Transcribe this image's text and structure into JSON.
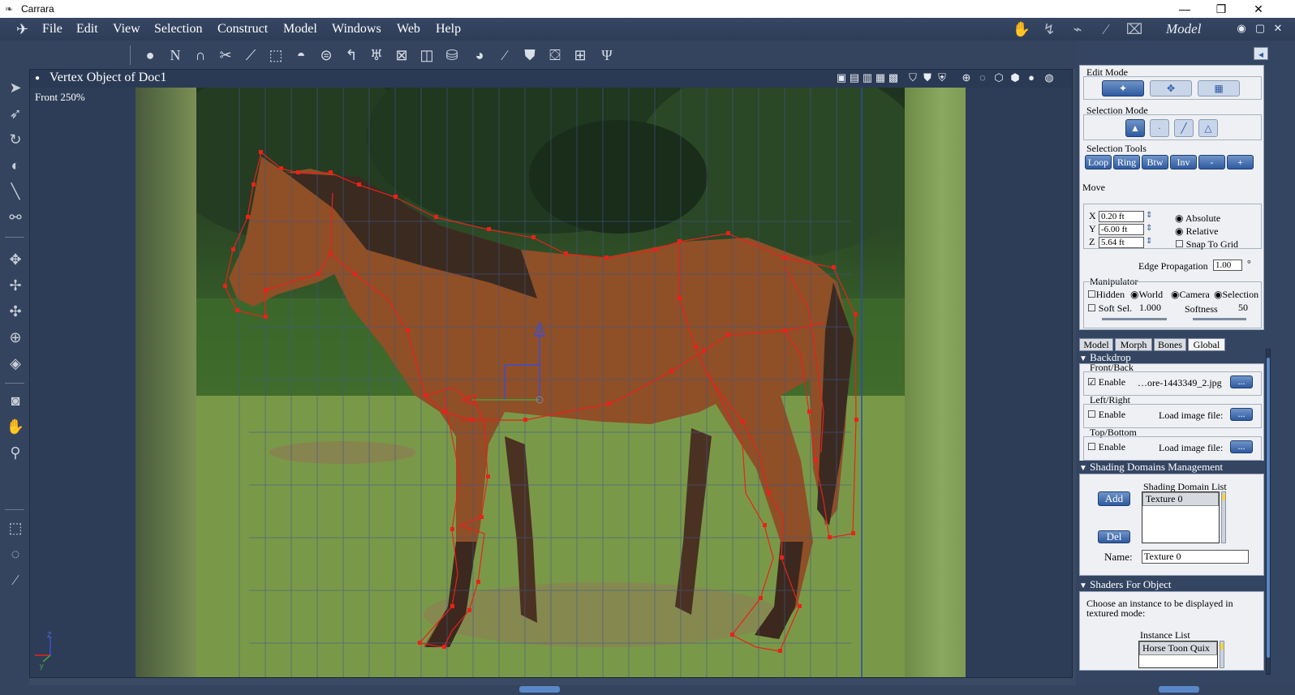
{
  "window": {
    "title": "Carrara",
    "minimize_glyph": "—",
    "restore_glyph": "❐",
    "close_glyph": "✕"
  },
  "menubar": {
    "items": [
      "File",
      "Edit",
      "View",
      "Selection",
      "Construct",
      "Model",
      "Windows",
      "Web",
      "Help"
    ],
    "room_label": "Model",
    "room_icons": [
      "assemble-room-icon",
      "model-room-icon",
      "storyboard-room-icon",
      "texture-room-icon",
      "render-room-icon"
    ]
  },
  "toolbar": {
    "tools": [
      "sphere-tool-icon",
      "spline-tool-icon",
      "magnet-tool-icon",
      "scissors-tool-icon",
      "knife-tool-icon",
      "scale-tool-icon",
      "dome-tool-icon",
      "lathe-tool-icon",
      "bend-tool-icon",
      "vase-tool-icon",
      "box-select-tool-icon",
      "cube-tool-icon",
      "cylinder-tool-icon",
      "cone-tool-icon",
      "pen-tool-icon",
      "deform-tool-icon",
      "morph-tool-icon",
      "extrude-tool-icon",
      "sweep-tool-icon"
    ]
  },
  "lefttools": {
    "tools": [
      "arrow-icon",
      "direct-select-icon",
      "rotate-icon",
      "trackball-icon",
      "measure-icon",
      "link-icon",
      "move-xy-icon",
      "move-xz-icon",
      "move-yz-icon",
      "move-3d-icon",
      "shading-icon",
      "camera-icon",
      "hand-icon",
      "zoom-icon",
      "marquee-icon",
      "lasso-icon",
      "brush-icon"
    ]
  },
  "viewport": {
    "title": "Vertex Object of Doc1",
    "view_label": "Front 250%",
    "backdrop_file": "…ore-1443349_2.jpg"
  },
  "right_panel": {
    "edit_mode_label": "Edit Mode",
    "selection_mode_label": "Selection Mode",
    "selection_tools_label": "Selection Tools",
    "selection_tools": [
      "Loop",
      "Ring",
      "Btw",
      "Inv",
      "-",
      "+"
    ],
    "move_label": "Move",
    "x_label": "X",
    "y_label": "Y",
    "z_label": "Z",
    "x_value": "0.20 ft",
    "y_value": "-6.00 ft",
    "z_value": "5.64 ft",
    "absolute_label": "Absolute",
    "relative_label": "Relative",
    "snap_label": "Snap To Grid",
    "edge_propagation_label": "Edge Propagation",
    "edge_propagation_value": "1.00",
    "edge_propagation_unit": "°",
    "manipulator_label": "Manipulator",
    "hidden_label": "Hidden",
    "world_label": "World",
    "camera_label": "Camera",
    "selection_label": "Selection",
    "soft_sel_label": "Soft Sel.",
    "soft_sel_value": "1.000",
    "softness_label": "Softness",
    "softness_value": "50",
    "tabs": [
      "Model",
      "Morph",
      "Bones",
      "Global"
    ],
    "backdrop_header": "Backdrop",
    "front_back_label": "Front/Back",
    "left_right_label": "Left/Right",
    "top_bottom_label": "Top/Bottom",
    "enable_label": "Enable",
    "load_image_label": "Load image file:",
    "browse_label": "...",
    "shading_header": "Shading Domains Management",
    "shading_list_label": "Shading Domain List",
    "add_label": "Add",
    "del_label": "Del",
    "shading_list": [
      "Texture 0"
    ],
    "name_label": "Name:",
    "name_value": "Texture 0",
    "shaders_header": "Shaders For Object",
    "shaders_desc": "Choose an instance to be displayed in textured mode:",
    "instance_list_label": "Instance List",
    "instance_list": [
      "Horse Toon Quix"
    ]
  },
  "glyphs": {
    "triangle_down": "▼",
    "radio_on": "◉",
    "radio_off": "○",
    "check_on": "☑",
    "check_off": "☐",
    "spin": "⇕",
    "axis_z": "Z",
    "axis_y": "y",
    "vp_dot": "●",
    "panel_collapse": "◂",
    "edit_vertex": "✦",
    "edit_poly": "✥",
    "edit_mesh": "▦",
    "sel_vertex": "▲",
    "sel_point": "·",
    "sel_edge": "╱",
    "sel_face": "△"
  },
  "colors": {
    "accent": "#2f5aa0",
    "ui_dark": "#344562",
    "selection_wire": "#e8221a",
    "gizmo_y": "#3a4fd6",
    "gizmo_x": "#e8221a",
    "gizmo_z": "#3fb03f"
  }
}
